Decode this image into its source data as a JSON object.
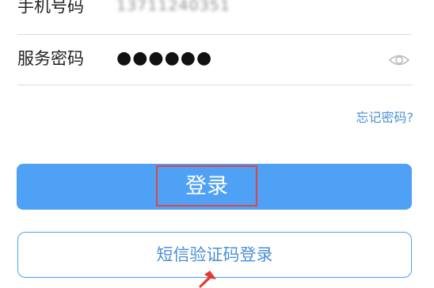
{
  "form": {
    "phone_label": "手机号码",
    "phone_value": "13711240351",
    "password_label": "服务密码",
    "password_value": "●●●●●●",
    "password_toggle_icon": "eye-icon",
    "forgot_label": "忘记密码?"
  },
  "actions": {
    "login_label": "登录",
    "sms_login_label": "短信验证码登录"
  },
  "colors": {
    "accent": "#4ea1f5",
    "link": "#4b8fd6",
    "highlight_box": "#e04545"
  }
}
